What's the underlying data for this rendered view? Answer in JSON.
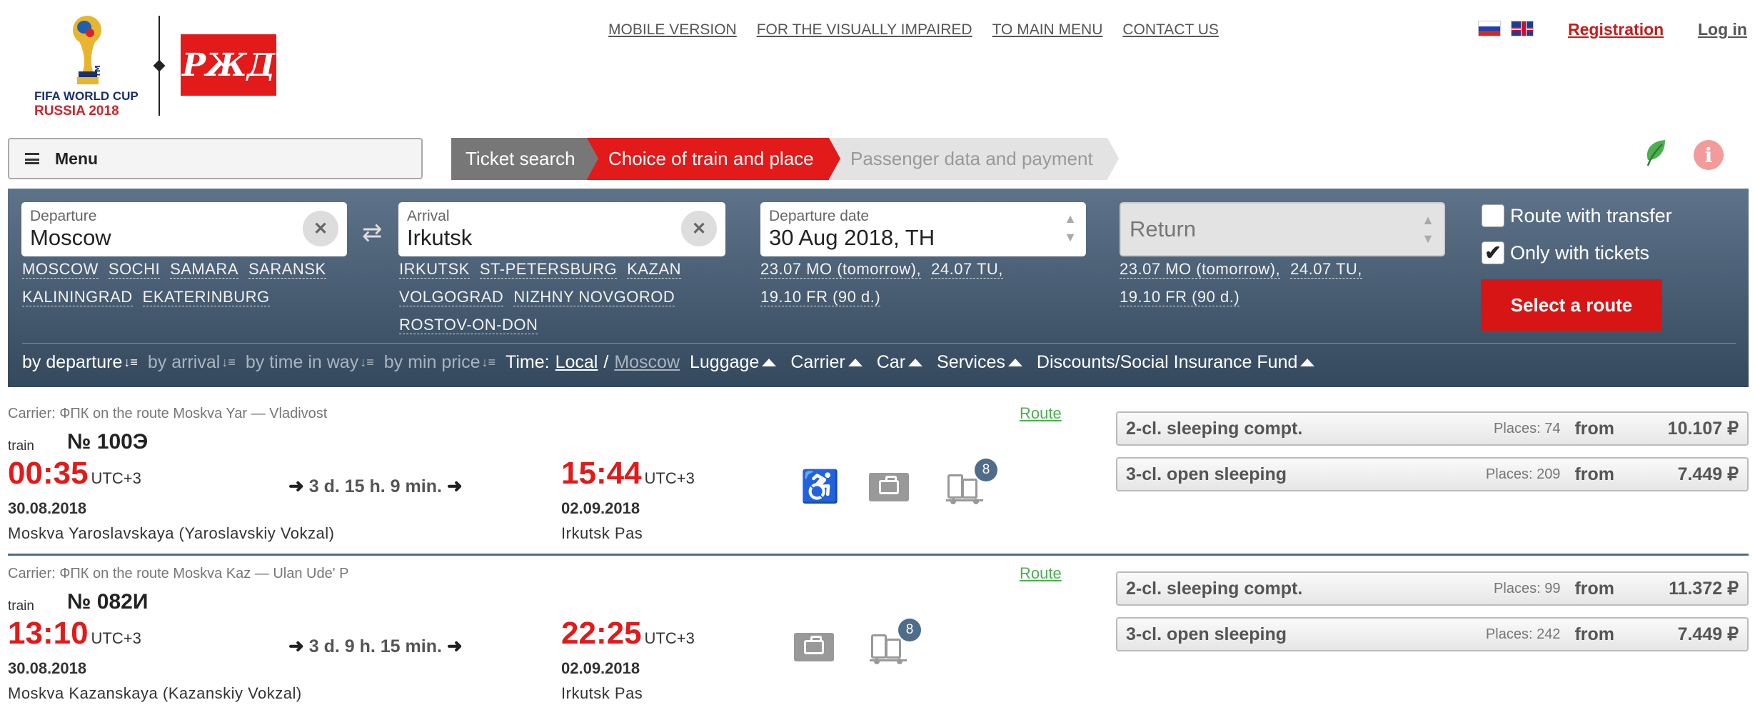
{
  "header": {
    "fifa_logo": {
      "line1": "FIFA WORLD CUP",
      "line2": "RUSSIA 2018"
    },
    "rzd_logo": "РЖД",
    "nav": [
      "MOBILE VERSION",
      "FOR THE VISUALLY IMPAIRED",
      "TO MAIN MENU",
      "CONTACT US"
    ],
    "registration": "Registration",
    "login": "Log in"
  },
  "menu": {
    "label": "Menu"
  },
  "steps": [
    "Ticket search",
    "Choice of train and place",
    "Passenger data and payment"
  ],
  "search": {
    "departure": {
      "label": "Departure",
      "value": "Moscow",
      "quick": [
        "MOSCOW",
        "SOCHI",
        "SAMARA",
        "SARANSK",
        "KALININGRAD",
        "EKATERINBURG"
      ]
    },
    "arrival": {
      "label": "Arrival",
      "value": "Irkutsk",
      "quick": [
        "IRKUTSK",
        "ST-PETERSBURG",
        "KAZAN",
        "VOLGOGRAD",
        "NIZHNY NOVGOROD",
        "ROSTOV-ON-DON"
      ]
    },
    "date": {
      "label": "Departure date",
      "value": "30 Aug 2018, TH",
      "quick": [
        "23.07 MO (tomorrow),",
        "24.07 TU,",
        "19.10 FR (90 d.)"
      ]
    },
    "return": {
      "placeholder": "Return",
      "quick": [
        "23.07 MO (tomorrow),",
        "24.07 TU,",
        "19.10 FR (90 d.)"
      ]
    },
    "route_with_transfer": {
      "label": "Route with transfer",
      "checked": false
    },
    "only_with_tickets": {
      "label": "Only with tickets",
      "checked": true
    },
    "select_route": "Select a route"
  },
  "sortbar": {
    "by_departure": "by departure",
    "by_arrival": "by arrival",
    "by_time": "by time in way",
    "by_price": "by min price",
    "time_label": "Time:",
    "local": "Local",
    "sep": "/",
    "moscow": "Moscow",
    "luggage": "Luggage",
    "carrier": "Carrier",
    "car": "Car",
    "services": "Services",
    "discounts": "Discounts/Social Insurance Fund"
  },
  "trains": [
    {
      "carrier": "Carrier: ФПК   on the route Moskva Yar — Vladivost",
      "route_link": "Route",
      "type": "train",
      "number": "№ 100Э",
      "dep_time": "00:35",
      "dep_tz": "UTC+3",
      "dep_date": "30.08.2018",
      "dep_station": "Moskva Yaroslavskaya (Yaroslavskiy Vokzal)",
      "duration": "3 d. 15 h. 9 min.",
      "arr_time": "15:44",
      "arr_tz": "UTC+3",
      "arr_date": "02.09.2018",
      "arr_station": "Irkutsk Pas",
      "luggage_count": "8",
      "fares": [
        {
          "class": "2-cl. sleeping compt.",
          "places": "Places: 74",
          "from": "from",
          "price": "10.107 ₽"
        },
        {
          "class": "3-cl. open sleeping",
          "places": "Places: 209",
          "from": "from",
          "price": "7.449 ₽"
        }
      ]
    },
    {
      "carrier": "Carrier: ФПК   on the route Moskva Kaz — Ulan Ude' P",
      "route_link": "Route",
      "type": "train",
      "number": "№ 082И",
      "dep_time": "13:10",
      "dep_tz": "UTC+3",
      "dep_date": "30.08.2018",
      "dep_station": "Moskva Kazanskaya (Kazanskiy Vokzal)",
      "duration": "3 d. 9 h. 15 min.",
      "arr_time": "22:25",
      "arr_tz": "UTC+3",
      "arr_date": "02.09.2018",
      "arr_station": "Irkutsk Pas",
      "luggage_count": "8",
      "fares": [
        {
          "class": "2-cl. sleeping compt.",
          "places": "Places: 99",
          "from": "from",
          "price": "11.372 ₽"
        },
        {
          "class": "3-cl. open sleeping",
          "places": "Places: 242",
          "from": "from",
          "price": "7.449 ₽"
        }
      ]
    }
  ],
  "colors": {
    "accent": "#e21a1a",
    "panel": "#4a6078",
    "link_green": "#4caf50"
  }
}
